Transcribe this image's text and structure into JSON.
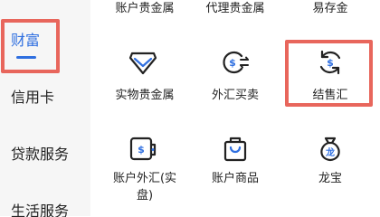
{
  "sidebar": {
    "items": [
      {
        "label": "财富",
        "active": true
      },
      {
        "label": "信用卡",
        "active": false
      },
      {
        "label": "贷款服务",
        "active": false
      },
      {
        "label": "生活服务",
        "active": false
      }
    ]
  },
  "grid": {
    "top_row": [
      {
        "label": "账户贵金属"
      },
      {
        "label": "代理贵金属"
      },
      {
        "label": "易存金"
      }
    ],
    "items": [
      {
        "label": "实物贵金属",
        "icon": "diamond-icon"
      },
      {
        "label": "外汇买卖",
        "icon": "dollar-exchange-icon"
      },
      {
        "label": "结售汇",
        "icon": "dollar-cycle-icon",
        "highlighted": true
      },
      {
        "label_line1": "账户外汇(实",
        "label_line2": "盘)",
        "icon": "dollar-wallet-icon"
      },
      {
        "label": "账户商品",
        "icon": "shopping-bag-icon"
      },
      {
        "label": "龙宝",
        "icon": "dragon-bag-icon",
        "icon_text": "龙",
        "dollar_glyph": "$"
      }
    ]
  },
  "colors": {
    "accent": "#2f6fe0",
    "highlight": "#e8665c",
    "icon_stroke": "#222222"
  }
}
